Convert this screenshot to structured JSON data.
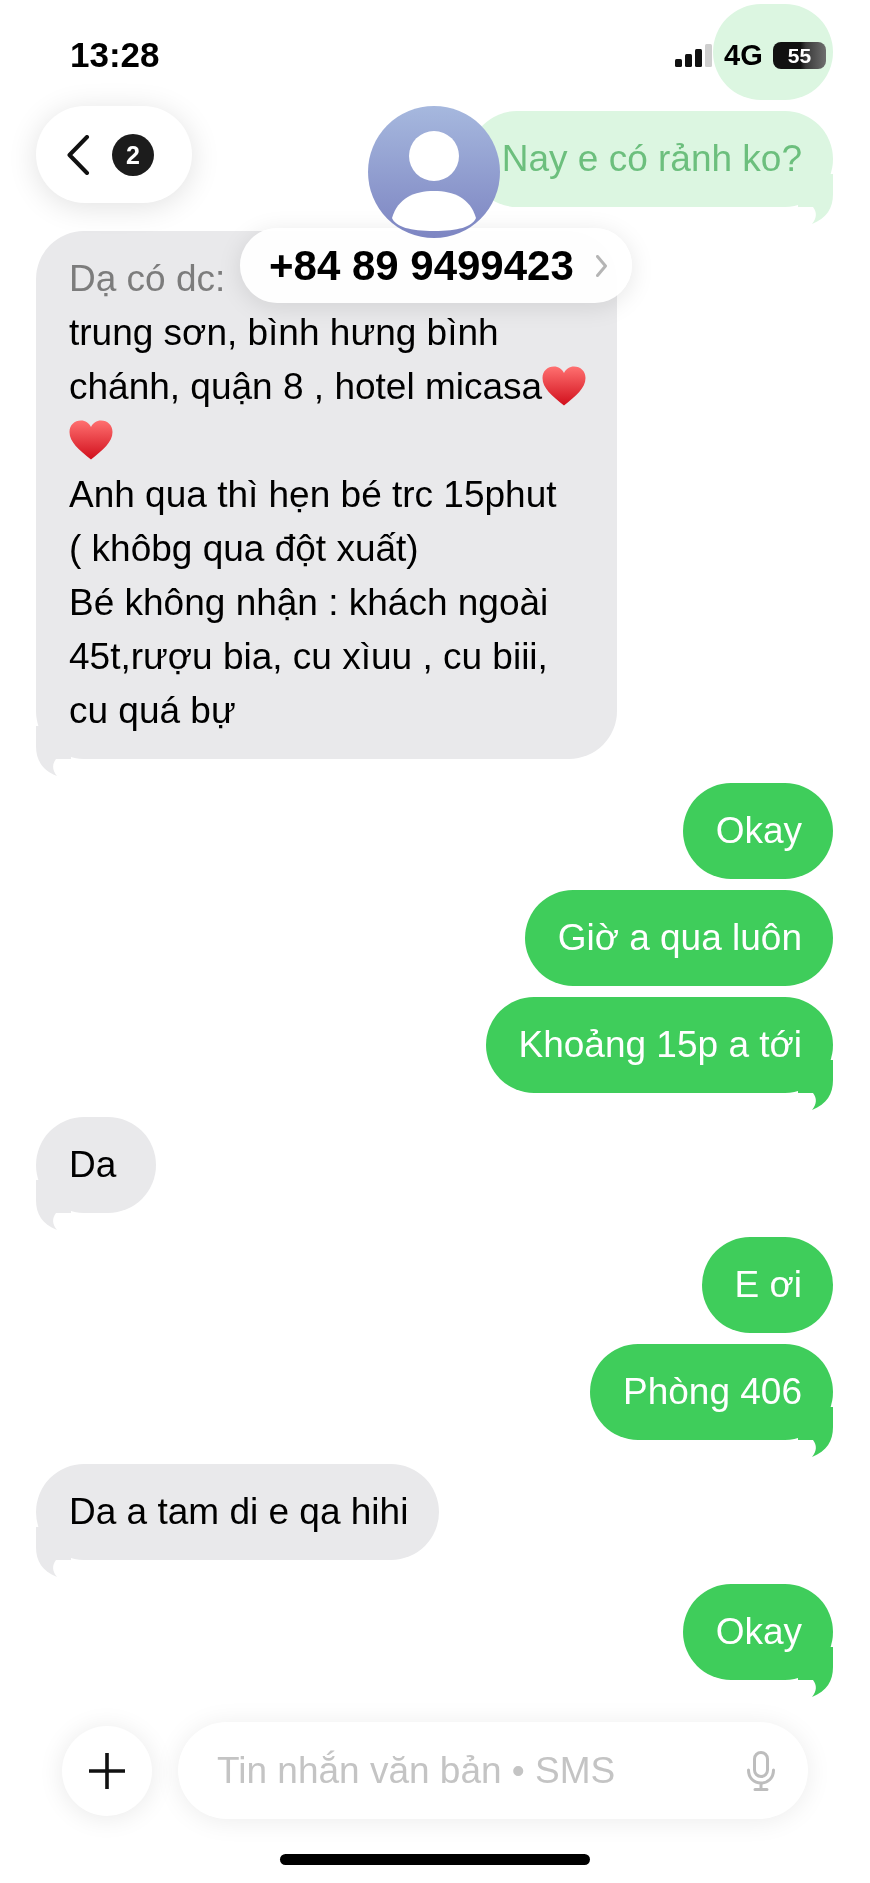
{
  "status_bar": {
    "time": "13:28",
    "network": "4G",
    "battery": "55"
  },
  "header": {
    "back_badge": "2",
    "contact": "+84 89 9499423"
  },
  "messages": [
    {
      "kind": "sent",
      "faded": true,
      "tail": false
    },
    {
      "kind": "sent",
      "faded": true,
      "tail": true,
      "text": "Nay e có rảnh ko?"
    },
    {
      "kind": "received",
      "faded": false,
      "tail": true,
      "body": [
        {
          "kind": "text",
          "new_line": false,
          "faded": true,
          "lines": [
            "Dạ có dc:"
          ]
        },
        {
          "kind": "text",
          "new_line": true,
          "faded": false,
          "lines": [
            "trung sơn, bình hưng bình",
            "chánh, quận 8 , hotel micasa"
          ]
        },
        {
          "kind": "heart",
          "new_line": false
        },
        {
          "kind": "heart",
          "new_line": true
        },
        {
          "kind": "text",
          "new_line": true,
          "faded": false,
          "lines": [
            "Anh qua thì hẹn bé trc 15phut",
            "( khôbg qua đột xuất)",
            "Bé không nhận : khách ngoài",
            "45t,rượu bia, cu xìuu , cu biii,",
            "cu quá bự"
          ]
        }
      ]
    },
    {
      "kind": "sent",
      "faded": false,
      "tail": false,
      "text": "Okay"
    },
    {
      "kind": "sent",
      "faded": false,
      "tail": false,
      "text": "Giờ a qua luôn"
    },
    {
      "kind": "sent",
      "faded": false,
      "tail": true,
      "text": "Khoảng 15p a tới"
    },
    {
      "kind": "received",
      "faded": false,
      "tail": true,
      "text": "Da"
    },
    {
      "kind": "sent",
      "faded": false,
      "tail": false,
      "text": "E ơi"
    },
    {
      "kind": "sent",
      "faded": false,
      "tail": true,
      "text": "Phòng 406"
    },
    {
      "kind": "received",
      "faded": false,
      "tail": true,
      "text": "Da a tam di e qa hihi"
    },
    {
      "kind": "sent",
      "faded": false,
      "tail": true,
      "text": "Okay"
    }
  ],
  "composer": {
    "placeholder": "Tin nhắn văn bản • SMS"
  }
}
